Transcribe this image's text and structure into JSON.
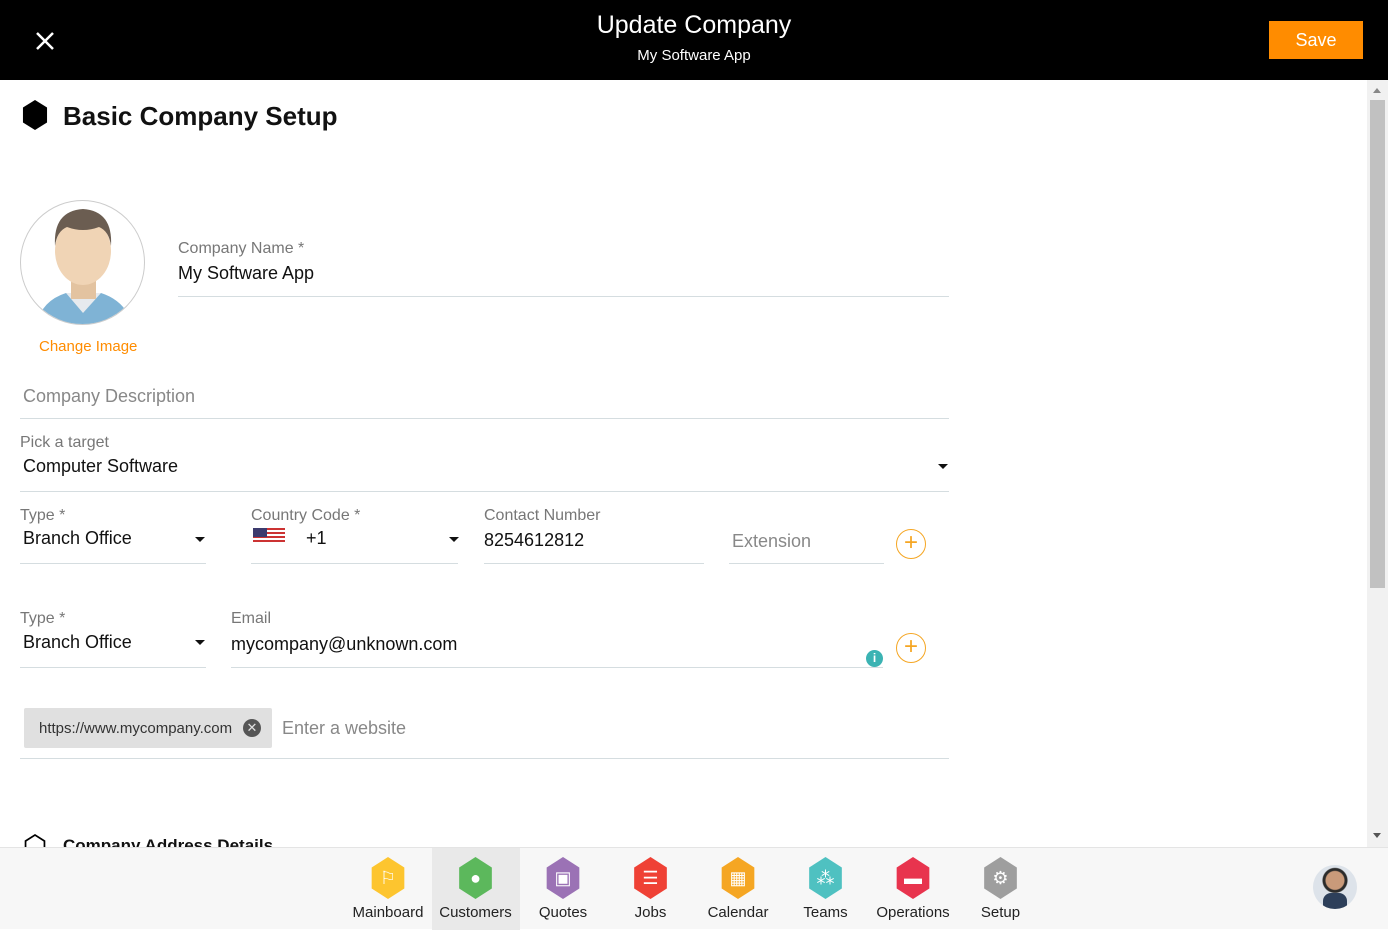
{
  "header": {
    "title": "Update Company",
    "subtitle": "My Software App",
    "save_label": "Save"
  },
  "section": {
    "title": "Basic Company Setup",
    "next_title": "Company Address Details"
  },
  "avatar": {
    "change_label": "Change Image"
  },
  "company_name": {
    "label": "Company Name *",
    "value": "My Software App"
  },
  "description": {
    "placeholder": "Company Description"
  },
  "target": {
    "label": "Pick a target",
    "value": "Computer Software"
  },
  "phone": {
    "type_label": "Type *",
    "type_value": "Branch Office",
    "cc_label": "Country Code *",
    "cc_value": "+1",
    "number_label": "Contact Number",
    "number_value": "8254612812",
    "ext_placeholder": "Extension"
  },
  "email": {
    "type_label": "Type *",
    "type_value": "Branch Office",
    "label": "Email",
    "value": "mycompany@unknown.com"
  },
  "website": {
    "chip": "https://www.mycompany.com",
    "placeholder": "Enter a website"
  },
  "nav": [
    {
      "label": "Mainboard",
      "icon": "mainboard-icon",
      "color": "#fdc52f",
      "glyph": "⚐"
    },
    {
      "label": "Customers",
      "icon": "user-icon",
      "color": "#5cb85c",
      "glyph": "●",
      "active": true
    },
    {
      "label": "Quotes",
      "icon": "quotes-icon",
      "color": "#9b72b5",
      "glyph": "▣"
    },
    {
      "label": "Jobs",
      "icon": "list-icon",
      "color": "#ef4135",
      "glyph": "☰"
    },
    {
      "label": "Calendar",
      "icon": "calendar-icon",
      "color": "#f5a623",
      "glyph": "▦"
    },
    {
      "label": "Teams",
      "icon": "teams-icon",
      "color": "#4fc1c1",
      "glyph": "⁂"
    },
    {
      "label": "Operations",
      "icon": "briefcase-icon",
      "color": "#e8344e",
      "glyph": "▬"
    },
    {
      "label": "Setup",
      "icon": "gear-icon",
      "color": "#9e9e9e",
      "glyph": "⚙"
    }
  ]
}
